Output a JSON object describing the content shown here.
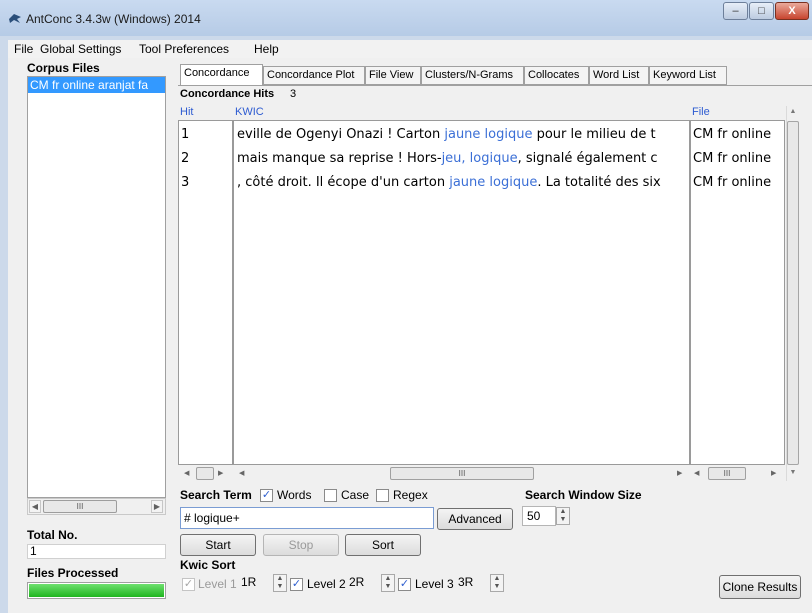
{
  "window": {
    "title": "AntConc 3.4.3w (Windows) 2014",
    "min": "–",
    "max": "□",
    "close": "X"
  },
  "menu": [
    "File",
    "Global Settings",
    "Tool Preferences",
    "Help"
  ],
  "sidebar": {
    "corpus_header": "Corpus Files",
    "files": [
      "CM fr online aranjat fa"
    ],
    "total_label": "Total No.",
    "total_value": "1",
    "processed_label": "Files Processed",
    "progress": 1.0,
    "hscroll_thumb": "III"
  },
  "tabs": [
    "Concordance",
    "Concordance Plot",
    "File View",
    "Clusters/N-Grams",
    "Collocates",
    "Word List",
    "Keyword List"
  ],
  "concordance": {
    "hits_label": "Concordance Hits",
    "hits_count": "3",
    "col_hit": "Hit",
    "col_kwic": "KWIC",
    "col_file": "File",
    "rows": [
      {
        "hit": "1",
        "left": "eville de Ogenyi Onazi ! Carton ",
        "key": "jaune logique",
        "right": " pour le milieu de t",
        "file": "CM fr online"
      },
      {
        "hit": "2",
        "left": " mais manque sa reprise ! Hors-",
        "key": "jeu, logique",
        "right": ", signalé également c",
        "file": "CM fr online"
      },
      {
        "hit": "3",
        "left": ", côté droit. Il écope d'un carton ",
        "key": "jaune logique",
        "right": ". La totalité des six",
        "file": "CM fr online"
      }
    ],
    "hscroll_thumb": "III"
  },
  "search": {
    "term_label": "Search Term",
    "words_label": "Words",
    "case_label": "Case",
    "regex_label": "Regex",
    "words_checked": true,
    "case_checked": false,
    "regex_checked": false,
    "query": "# logique+",
    "advanced_label": "Advanced",
    "window_label": "Search Window Size",
    "window_value": "50",
    "start_label": "Start",
    "stop_label": "Stop",
    "sort_label": "Sort"
  },
  "kwic_sort": {
    "label": "Kwic Sort",
    "level1_label": "Level 1",
    "level1_value": "1R",
    "level2_label": "Level 2",
    "level2_value": "2R",
    "level3_label": "Level 3",
    "level3_value": "3R",
    "clone_label": "Clone Results"
  },
  "colors": {
    "accent": "#3399ff",
    "keyword": "#3b6fd6",
    "progress": "#22c022"
  }
}
